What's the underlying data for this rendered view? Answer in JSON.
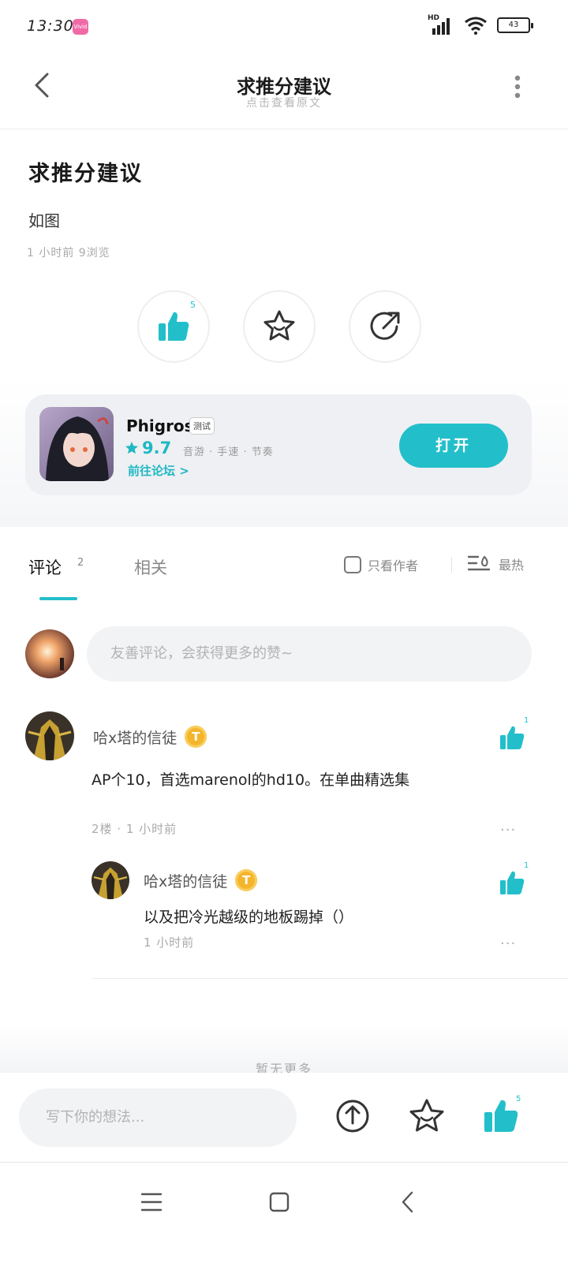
{
  "status_bar": {
    "time": "13:30",
    "app_badge": "Vivid",
    "network": "HD",
    "battery": "43"
  },
  "header": {
    "title": "求推分建议",
    "subtitle": "点击查看原文"
  },
  "post": {
    "title": "求推分建议",
    "body": "如图",
    "meta": "1 小时前  9浏览",
    "like_count": "5"
  },
  "game": {
    "name": "Phigros",
    "tag": "测试",
    "rating": "9.7",
    "genres": "音游 · 手速 · 节奏",
    "forum_link": "前往论坛 >",
    "open_label": "打开"
  },
  "tabs": {
    "comments_label": "评论",
    "comments_count": "2",
    "related_label": "相关",
    "author_only_label": "只看作者",
    "sort_label": "最热"
  },
  "comment_input": {
    "placeholder": "友善评论，会获得更多的赞~"
  },
  "comments": [
    {
      "author": "哈x塔的信徒",
      "badge": "T",
      "text": "AP个10，首选marenol的hd10。在单曲精选集",
      "meta": "2楼 · 1 小时前",
      "likes": "1",
      "more": "···"
    }
  ],
  "replies": [
    {
      "author": "哈x塔的信徒",
      "badge": "T",
      "text": "以及把冷光越级的地板踢掉（）",
      "meta": "1 小时前",
      "likes": "1",
      "more": "···"
    }
  ],
  "more_hint": "暂无更多",
  "bottom_bar": {
    "placeholder": "写下你的想法...",
    "like_count": "5"
  },
  "colors": {
    "accent": "#22bfca",
    "coin": "#f4b52c"
  },
  "icons": {
    "back": "chevron-left-icon",
    "more": "vertical-dots-icon",
    "like": "thumbs-up-icon",
    "favorite": "star-face-icon",
    "share": "share-arrow-icon",
    "sort": "sort-lines-icon",
    "upload": "upload-icon",
    "nav_menu": "menu-lines-icon",
    "nav_home": "square-icon",
    "nav_back": "triangle-back-icon"
  }
}
